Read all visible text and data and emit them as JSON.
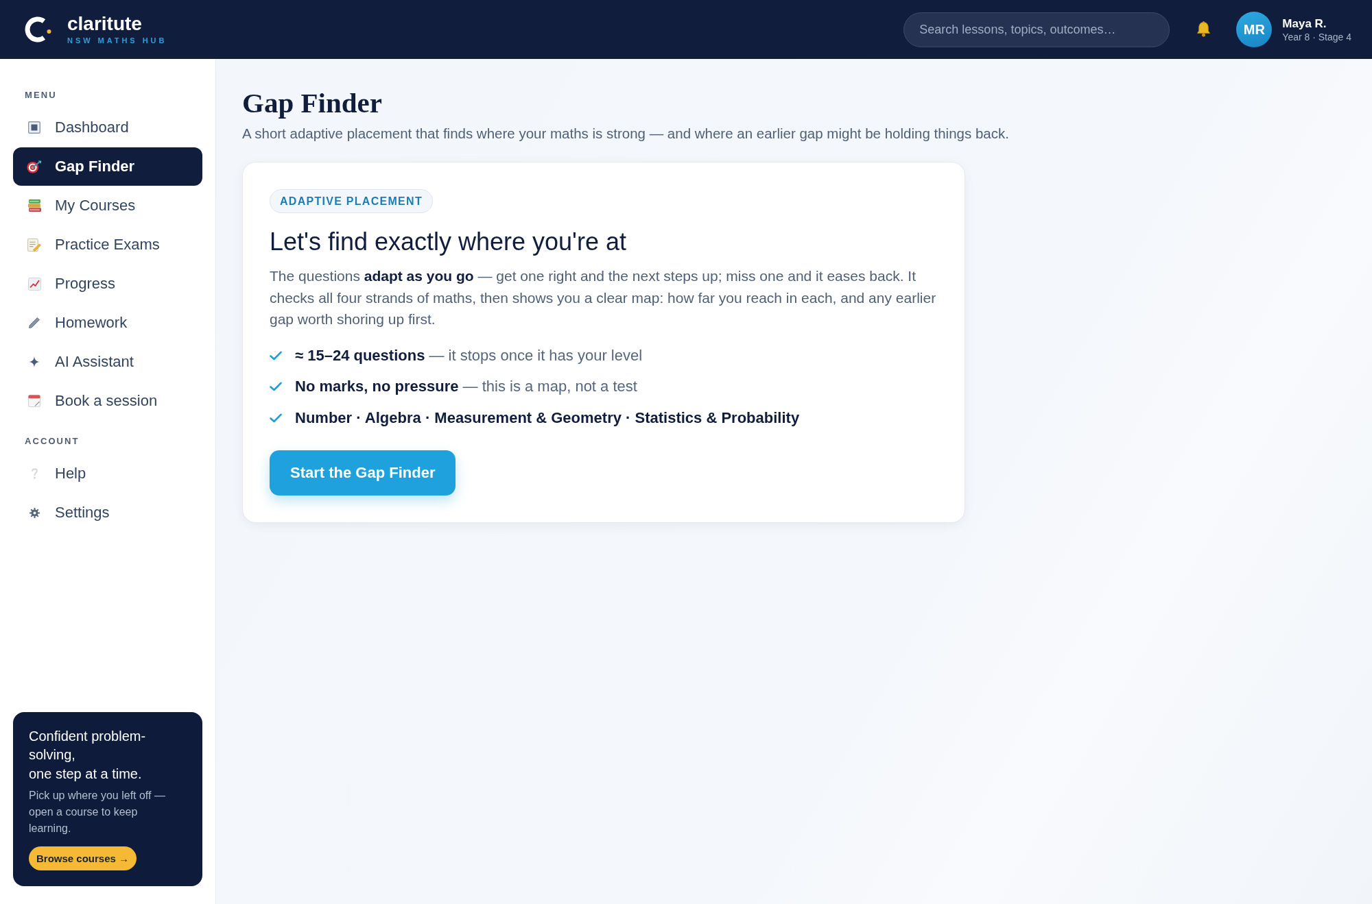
{
  "header": {
    "brand": {
      "name": "claritute",
      "tagline": "NSW MATHS HUB"
    },
    "search": {
      "placeholder": "Search lessons, topics, outcomes…"
    },
    "user": {
      "initials": "MR",
      "name": "Maya R.",
      "detail": "Year 8 · Stage 4"
    }
  },
  "sidebar": {
    "sections": [
      {
        "heading": "MENU",
        "items": [
          {
            "label": "Dashboard",
            "selected": false
          },
          {
            "label": "Gap Finder",
            "selected": true
          },
          {
            "label": "My Courses",
            "selected": false
          },
          {
            "label": "Practice Exams",
            "selected": false
          },
          {
            "label": "Progress",
            "selected": false
          },
          {
            "label": "Homework",
            "selected": false
          },
          {
            "label": "AI Assistant",
            "selected": false
          },
          {
            "label": "Book a session",
            "selected": false
          }
        ]
      },
      {
        "heading": "ACCOUNT",
        "items": [
          {
            "label": "Help",
            "selected": false
          },
          {
            "label": "Settings",
            "selected": false
          }
        ]
      }
    ],
    "promo": {
      "title_lines": [
        "Confident problem-solving,",
        "one step at a time."
      ],
      "text": "Pick up where you left off — open a course to keep learning.",
      "button": "Browse courses →"
    }
  },
  "page": {
    "title": "Gap Finder",
    "subtitle": "A short adaptive placement that finds where your maths is strong — and where an earlier gap might be holding things back."
  },
  "card": {
    "label": "ADAPTIVE PLACEMENT",
    "heading": "Let's find exactly where you're at",
    "body": "The questions **adapt as you go** — get one right and the next steps up; miss one and it eases back. It checks all four strands of maths, then shows you a clear map: how far you reach in each, and any earlier gap worth shoring up first.",
    "checklist": [
      {
        "lead": "≈ 15–24 questions",
        "rest": "— it stops once it has your level"
      },
      {
        "lead": "No marks, no pressure",
        "rest": "— this is a map, not a test"
      },
      {
        "lead": "Number · Algebra · Measurement & Geometry · Statistics & Probability"
      }
    ],
    "button": "Start the Gap Finder"
  }
}
